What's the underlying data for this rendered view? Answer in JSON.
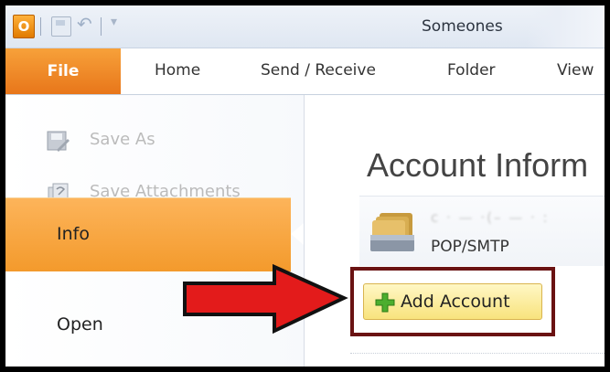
{
  "titlebar": {
    "app_icon_letter": "O",
    "window_title": "Someones"
  },
  "tabs": {
    "file": "File",
    "home": "Home",
    "send_receive": "Send / Receive",
    "folder": "Folder",
    "view": "View"
  },
  "nav": {
    "save_as": "Save As",
    "save_attachments": "Save Attachments",
    "info": "Info",
    "open": "Open"
  },
  "main": {
    "heading": "Account Inform",
    "account_name_redacted": "c · — ·(– — · :",
    "account_type": "POP/SMTP",
    "add_account": "Add Account"
  },
  "colors": {
    "file_tab": "#e8761a",
    "info_highlight": "#f8a540",
    "arrow": "#e31b1b",
    "highlight_frame": "#6a1212"
  }
}
